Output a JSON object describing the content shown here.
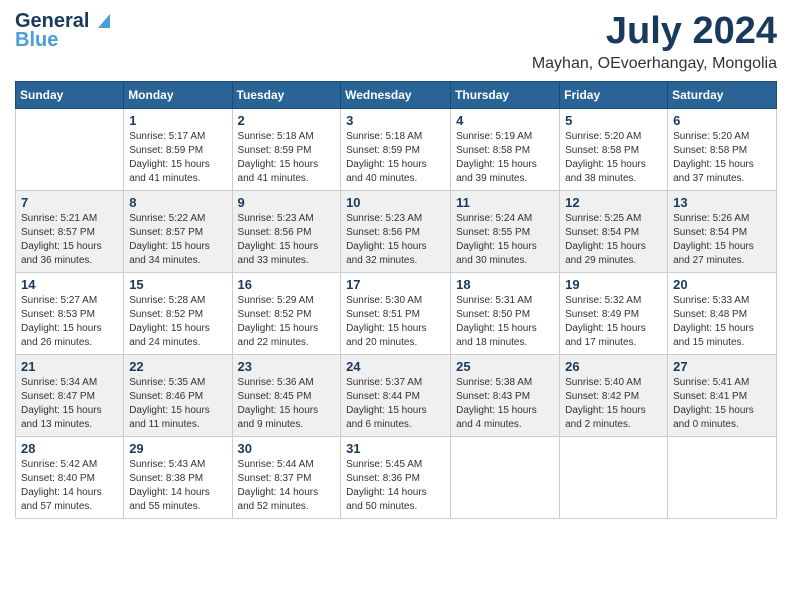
{
  "header": {
    "logo_line1": "General",
    "logo_line2": "Blue",
    "title": "July 2024",
    "subtitle": "Mayhan, OEvoerhangay, Mongolia"
  },
  "calendar": {
    "days_of_week": [
      "Sunday",
      "Monday",
      "Tuesday",
      "Wednesday",
      "Thursday",
      "Friday",
      "Saturday"
    ],
    "weeks": [
      [
        {
          "day": "",
          "sunrise": "",
          "sunset": "",
          "daylight": ""
        },
        {
          "day": "1",
          "sunrise": "Sunrise: 5:17 AM",
          "sunset": "Sunset: 8:59 PM",
          "daylight": "Daylight: 15 hours and 41 minutes."
        },
        {
          "day": "2",
          "sunrise": "Sunrise: 5:18 AM",
          "sunset": "Sunset: 8:59 PM",
          "daylight": "Daylight: 15 hours and 41 minutes."
        },
        {
          "day": "3",
          "sunrise": "Sunrise: 5:18 AM",
          "sunset": "Sunset: 8:59 PM",
          "daylight": "Daylight: 15 hours and 40 minutes."
        },
        {
          "day": "4",
          "sunrise": "Sunrise: 5:19 AM",
          "sunset": "Sunset: 8:58 PM",
          "daylight": "Daylight: 15 hours and 39 minutes."
        },
        {
          "day": "5",
          "sunrise": "Sunrise: 5:20 AM",
          "sunset": "Sunset: 8:58 PM",
          "daylight": "Daylight: 15 hours and 38 minutes."
        },
        {
          "day": "6",
          "sunrise": "Sunrise: 5:20 AM",
          "sunset": "Sunset: 8:58 PM",
          "daylight": "Daylight: 15 hours and 37 minutes."
        }
      ],
      [
        {
          "day": "7",
          "sunrise": "Sunrise: 5:21 AM",
          "sunset": "Sunset: 8:57 PM",
          "daylight": "Daylight: 15 hours and 36 minutes."
        },
        {
          "day": "8",
          "sunrise": "Sunrise: 5:22 AM",
          "sunset": "Sunset: 8:57 PM",
          "daylight": "Daylight: 15 hours and 34 minutes."
        },
        {
          "day": "9",
          "sunrise": "Sunrise: 5:23 AM",
          "sunset": "Sunset: 8:56 PM",
          "daylight": "Daylight: 15 hours and 33 minutes."
        },
        {
          "day": "10",
          "sunrise": "Sunrise: 5:23 AM",
          "sunset": "Sunset: 8:56 PM",
          "daylight": "Daylight: 15 hours and 32 minutes."
        },
        {
          "day": "11",
          "sunrise": "Sunrise: 5:24 AM",
          "sunset": "Sunset: 8:55 PM",
          "daylight": "Daylight: 15 hours and 30 minutes."
        },
        {
          "day": "12",
          "sunrise": "Sunrise: 5:25 AM",
          "sunset": "Sunset: 8:54 PM",
          "daylight": "Daylight: 15 hours and 29 minutes."
        },
        {
          "day": "13",
          "sunrise": "Sunrise: 5:26 AM",
          "sunset": "Sunset: 8:54 PM",
          "daylight": "Daylight: 15 hours and 27 minutes."
        }
      ],
      [
        {
          "day": "14",
          "sunrise": "Sunrise: 5:27 AM",
          "sunset": "Sunset: 8:53 PM",
          "daylight": "Daylight: 15 hours and 26 minutes."
        },
        {
          "day": "15",
          "sunrise": "Sunrise: 5:28 AM",
          "sunset": "Sunset: 8:52 PM",
          "daylight": "Daylight: 15 hours and 24 minutes."
        },
        {
          "day": "16",
          "sunrise": "Sunrise: 5:29 AM",
          "sunset": "Sunset: 8:52 PM",
          "daylight": "Daylight: 15 hours and 22 minutes."
        },
        {
          "day": "17",
          "sunrise": "Sunrise: 5:30 AM",
          "sunset": "Sunset: 8:51 PM",
          "daylight": "Daylight: 15 hours and 20 minutes."
        },
        {
          "day": "18",
          "sunrise": "Sunrise: 5:31 AM",
          "sunset": "Sunset: 8:50 PM",
          "daylight": "Daylight: 15 hours and 18 minutes."
        },
        {
          "day": "19",
          "sunrise": "Sunrise: 5:32 AM",
          "sunset": "Sunset: 8:49 PM",
          "daylight": "Daylight: 15 hours and 17 minutes."
        },
        {
          "day": "20",
          "sunrise": "Sunrise: 5:33 AM",
          "sunset": "Sunset: 8:48 PM",
          "daylight": "Daylight: 15 hours and 15 minutes."
        }
      ],
      [
        {
          "day": "21",
          "sunrise": "Sunrise: 5:34 AM",
          "sunset": "Sunset: 8:47 PM",
          "daylight": "Daylight: 15 hours and 13 minutes."
        },
        {
          "day": "22",
          "sunrise": "Sunrise: 5:35 AM",
          "sunset": "Sunset: 8:46 PM",
          "daylight": "Daylight: 15 hours and 11 minutes."
        },
        {
          "day": "23",
          "sunrise": "Sunrise: 5:36 AM",
          "sunset": "Sunset: 8:45 PM",
          "daylight": "Daylight: 15 hours and 9 minutes."
        },
        {
          "day": "24",
          "sunrise": "Sunrise: 5:37 AM",
          "sunset": "Sunset: 8:44 PM",
          "daylight": "Daylight: 15 hours and 6 minutes."
        },
        {
          "day": "25",
          "sunrise": "Sunrise: 5:38 AM",
          "sunset": "Sunset: 8:43 PM",
          "daylight": "Daylight: 15 hours and 4 minutes."
        },
        {
          "day": "26",
          "sunrise": "Sunrise: 5:40 AM",
          "sunset": "Sunset: 8:42 PM",
          "daylight": "Daylight: 15 hours and 2 minutes."
        },
        {
          "day": "27",
          "sunrise": "Sunrise: 5:41 AM",
          "sunset": "Sunset: 8:41 PM",
          "daylight": "Daylight: 15 hours and 0 minutes."
        }
      ],
      [
        {
          "day": "28",
          "sunrise": "Sunrise: 5:42 AM",
          "sunset": "Sunset: 8:40 PM",
          "daylight": "Daylight: 14 hours and 57 minutes."
        },
        {
          "day": "29",
          "sunrise": "Sunrise: 5:43 AM",
          "sunset": "Sunset: 8:38 PM",
          "daylight": "Daylight: 14 hours and 55 minutes."
        },
        {
          "day": "30",
          "sunrise": "Sunrise: 5:44 AM",
          "sunset": "Sunset: 8:37 PM",
          "daylight": "Daylight: 14 hours and 52 minutes."
        },
        {
          "day": "31",
          "sunrise": "Sunrise: 5:45 AM",
          "sunset": "Sunset: 8:36 PM",
          "daylight": "Daylight: 14 hours and 50 minutes."
        },
        {
          "day": "",
          "sunrise": "",
          "sunset": "",
          "daylight": ""
        },
        {
          "day": "",
          "sunrise": "",
          "sunset": "",
          "daylight": ""
        },
        {
          "day": "",
          "sunrise": "",
          "sunset": "",
          "daylight": ""
        }
      ]
    ]
  }
}
